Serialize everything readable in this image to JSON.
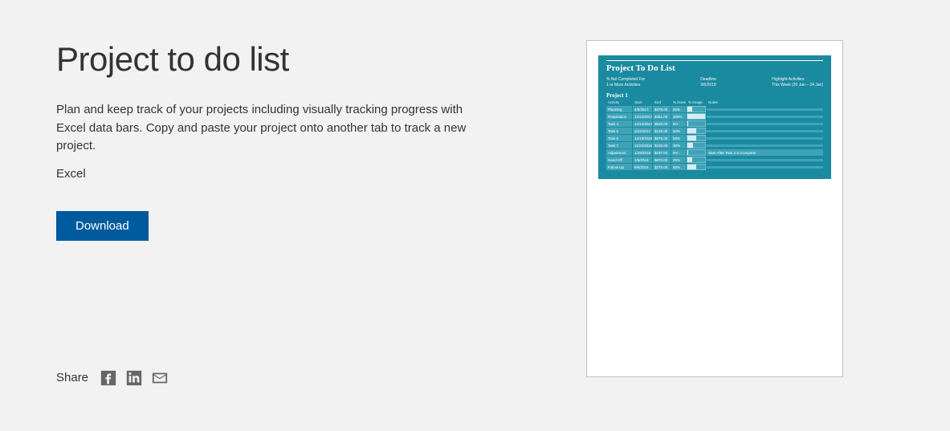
{
  "page": {
    "title": "Project to do list",
    "description": "Plan and keep track of your projects including visually tracking progress with Excel data bars. Copy and paste your project onto another tab to track a new project.",
    "app_name": "Excel",
    "download_label": "Download",
    "share_label": "Share"
  },
  "preview": {
    "title": "Project To Do List",
    "meta_left_label": "% Not Completed For",
    "meta_left_value": "1 or More Activities",
    "meta_mid_label": "Deadline",
    "meta_mid_value": "3/6/2018",
    "meta_right_label": "Highlight Activities",
    "meta_right_value": "This Week (20 Jan – 24 Jan)",
    "project_label": "Project 1",
    "headers": [
      "Activity",
      "Start",
      "End",
      "% Done",
      "% Image",
      "Notes"
    ],
    "rows": [
      {
        "activity": "Planning",
        "start": "4/9/2017",
        "end": "$476.00",
        "pct": "25%",
        "bar": 25,
        "note": ""
      },
      {
        "activity": "Preparation",
        "start": "12/24/2017",
        "end": "$451.00",
        "pct": "100%",
        "bar": 100,
        "note": ""
      },
      {
        "activity": "Task 4",
        "start": "12/24/2017",
        "end": "$520.00",
        "pct": "5%",
        "bar": 5,
        "note": ""
      },
      {
        "activity": "Task 5",
        "start": "3/22/2017",
        "end": "$120.00",
        "pct": "50%",
        "bar": 50,
        "note": ""
      },
      {
        "activity": "Task 6",
        "start": "12/19/2015",
        "end": "$975.00",
        "pct": "50%",
        "bar": 50,
        "note": ""
      },
      {
        "activity": "Task 7",
        "start": "11/22/2015",
        "end": "$230.00",
        "pct": "30%",
        "bar": 30,
        "note": ""
      },
      {
        "activity": "Adjustment",
        "start": "1/29/2016",
        "end": "$197.00",
        "pct": "5%",
        "bar": 5,
        "note": "Start After Task 4 is Complete"
      },
      {
        "activity": "Hand Off",
        "start": "1/6/2018",
        "end": "$670.00",
        "pct": "25%",
        "bar": 25,
        "note": ""
      },
      {
        "activity": "Follow Up",
        "start": "8/5/2016",
        "end": "$275.00",
        "pct": "50%",
        "bar": 50,
        "note": ""
      }
    ]
  }
}
